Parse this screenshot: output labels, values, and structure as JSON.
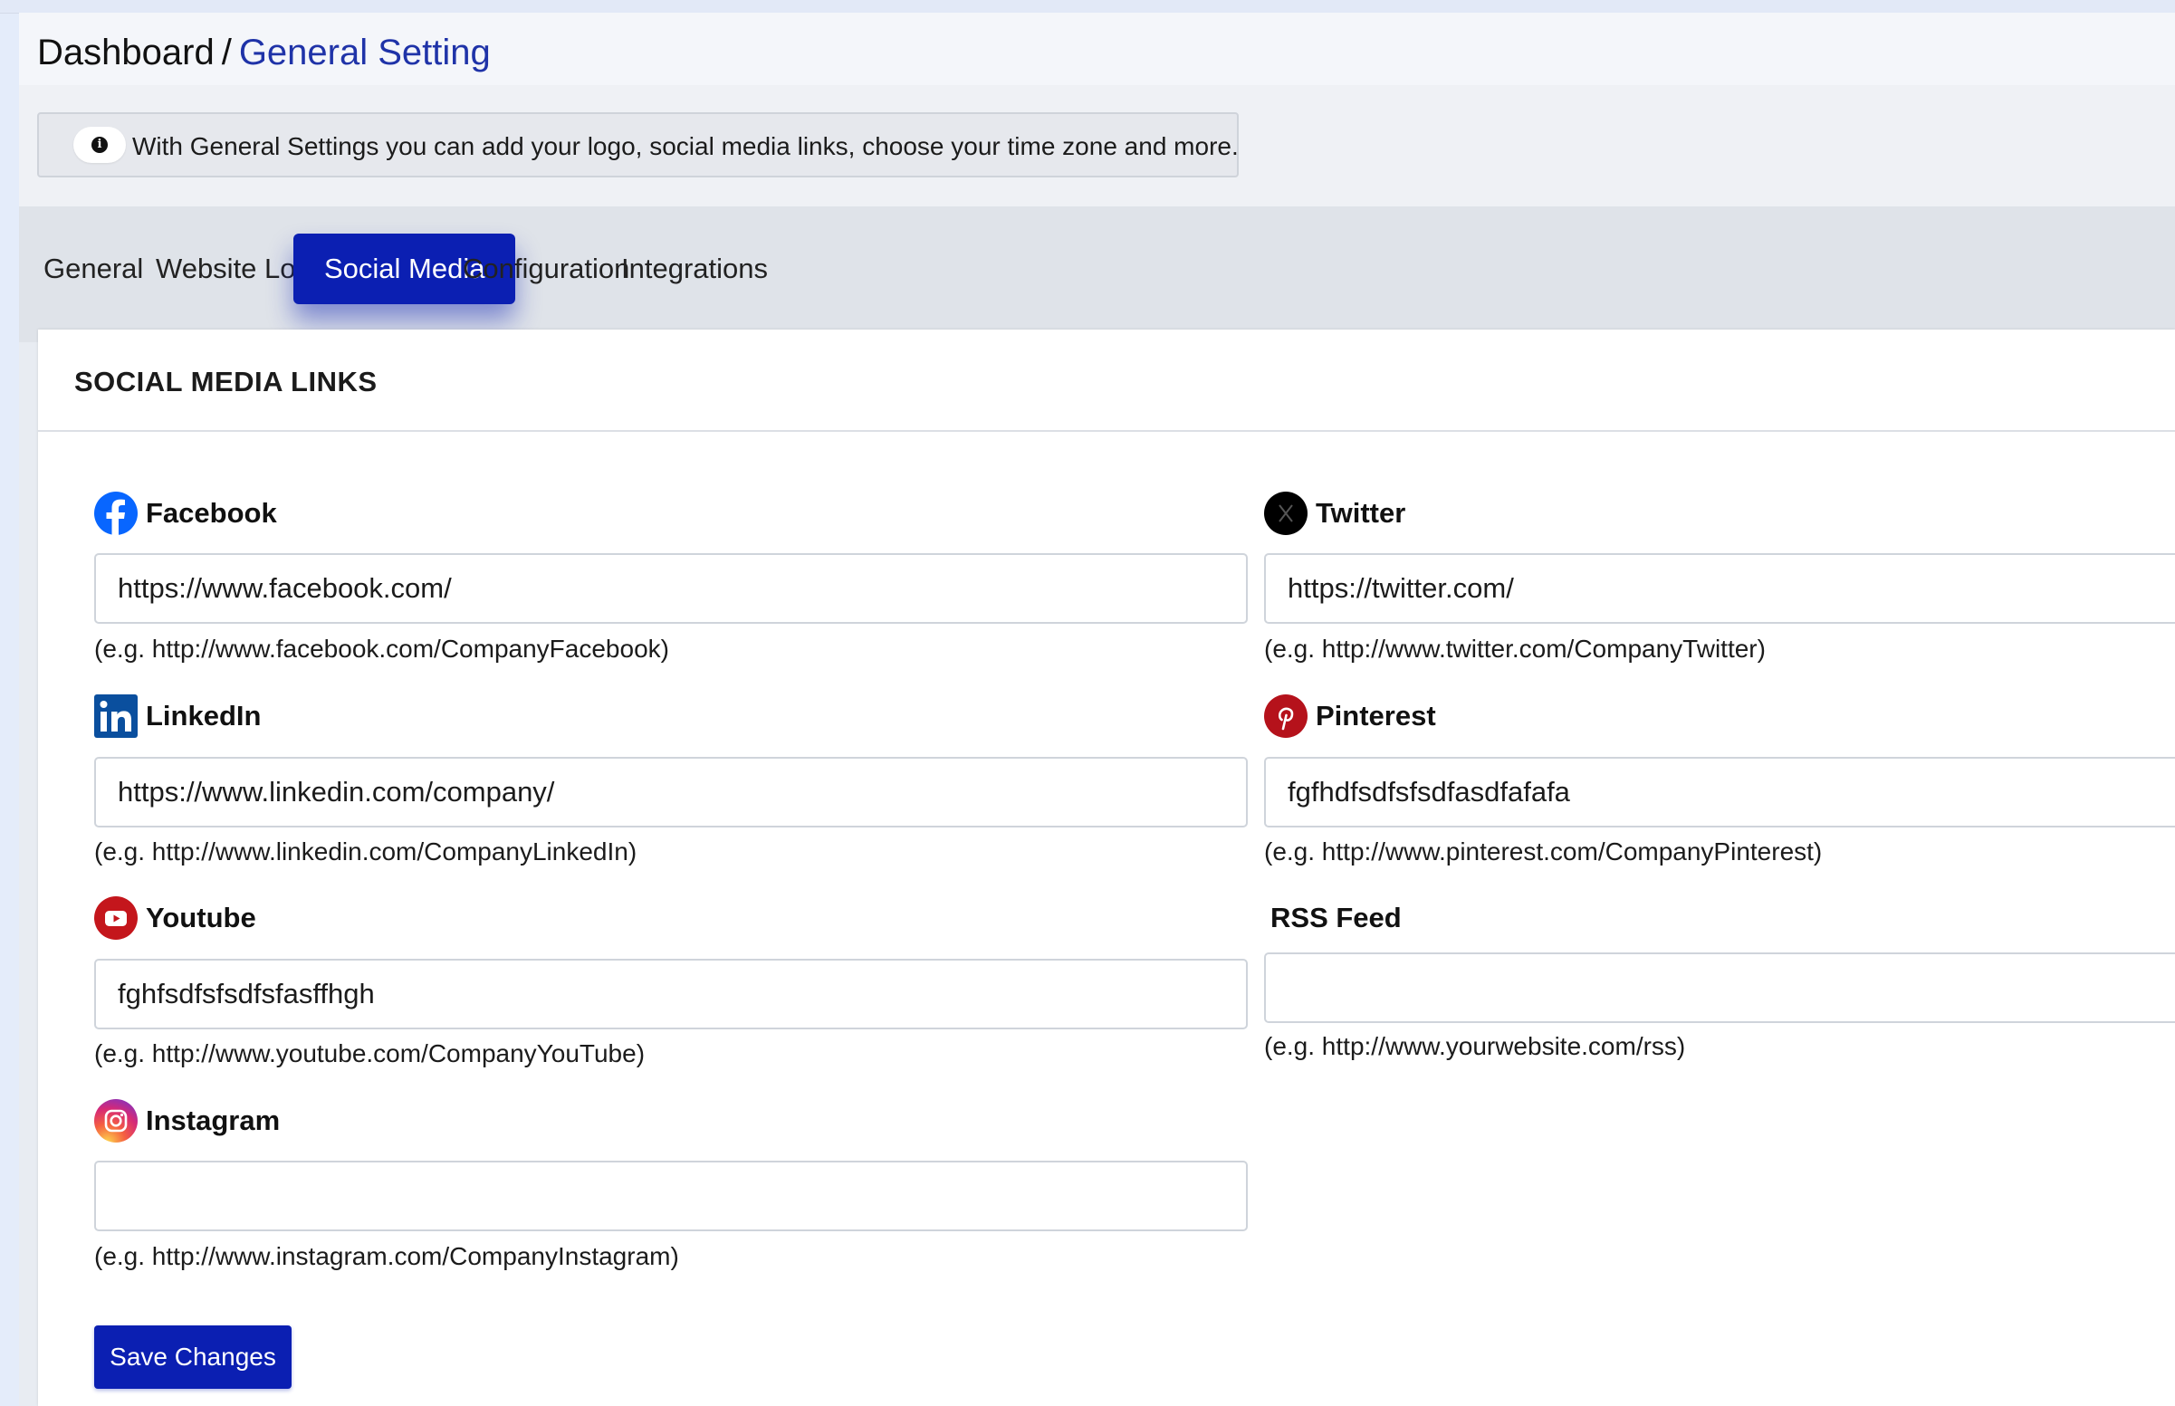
{
  "breadcrumb": {
    "root": "Dashboard",
    "separator": "/",
    "current": "General Setting"
  },
  "alert": {
    "icon": "info-icon",
    "text": "With General Settings you can add your logo, social media links, choose your time zone and more."
  },
  "tabs": [
    {
      "label": "General",
      "active": false
    },
    {
      "label": "Website Logo",
      "active": false
    },
    {
      "label": "Social Media",
      "active": true
    },
    {
      "label": "Configuration",
      "active": false
    },
    {
      "label": "Integrations",
      "active": false
    }
  ],
  "card": {
    "title": "SOCIAL MEDIA LINKS"
  },
  "fields": {
    "facebook": {
      "label": "Facebook",
      "icon": "facebook-icon",
      "value": "https://www.facebook.com/",
      "help": "(e.g. http://www.facebook.com/CompanyFacebook)"
    },
    "twitter": {
      "label": "Twitter",
      "icon": "x-twitter-icon",
      "value": "https://twitter.com/",
      "help": "(e.g. http://www.twitter.com/CompanyTwitter)"
    },
    "linkedin": {
      "label": "LinkedIn",
      "icon": "linkedin-icon",
      "value": "https://www.linkedin.com/company/",
      "help": "(e.g. http://www.linkedin.com/CompanyLinkedIn)"
    },
    "pinterest": {
      "label": "Pinterest",
      "icon": "pinterest-icon",
      "value": "fgfhdfsdfsfsdfasdfafafa",
      "help": "(e.g. http://www.pinterest.com/CompanyPinterest)"
    },
    "youtube": {
      "label": "Youtube",
      "icon": "youtube-icon",
      "value": "fghfsdfsfsdfsfasffhgh",
      "help": "(e.g. http://www.youtube.com/CompanyYouTube)"
    },
    "rss": {
      "label": "RSS Feed",
      "value": "",
      "help": "(e.g. http://www.yourwebsite.com/rss)"
    },
    "instagram": {
      "label": "Instagram",
      "icon": "instagram-icon",
      "value": "",
      "help": "(e.g. http://www.instagram.com/CompanyInstagram)"
    }
  },
  "actions": {
    "save_label": "Save Changes"
  },
  "colors": {
    "primary": "#0b1fb2",
    "breadcrumb_link": "#1f33a8",
    "facebook": "#0866ff",
    "linkedin": "#0a4f9e",
    "pinterest": "#b5121b",
    "youtube": "#c4161c"
  }
}
